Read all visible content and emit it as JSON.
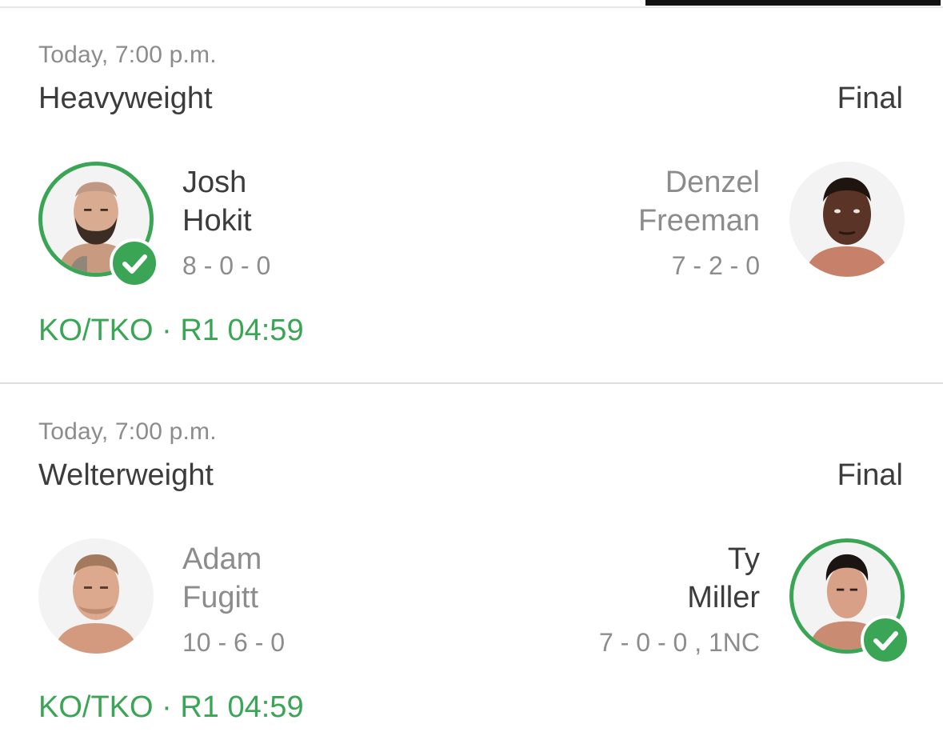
{
  "fights": [
    {
      "time": "Today, 7:00 p.m.",
      "weight_class": "Heavyweight",
      "status": "Final",
      "left": {
        "first": "Josh",
        "last": "Hokit",
        "record": "8 - 0 - 0",
        "winner": true
      },
      "right": {
        "first": "Denzel",
        "last": "Freeman",
        "record": "7 - 2 - 0",
        "winner": false
      },
      "result": "KO/TKO · R1 04:59"
    },
    {
      "time": "Today, 7:00 p.m.",
      "weight_class": "Welterweight",
      "status": "Final",
      "left": {
        "first": "Adam",
        "last": "Fugitt",
        "record": "10 - 6 - 0",
        "winner": false
      },
      "right": {
        "first": "Ty",
        "last": "Miller",
        "record": "7 - 0 - 0 , 1NC",
        "winner": true
      },
      "result": "KO/TKO · R1 04:59"
    }
  ],
  "colors": {
    "winner_green": "#3aa655",
    "text_dark": "#3c3c3c",
    "text_muted": "#8c8c8c",
    "divider": "#dedede"
  },
  "icons": {
    "winner": "checkmark-icon"
  }
}
